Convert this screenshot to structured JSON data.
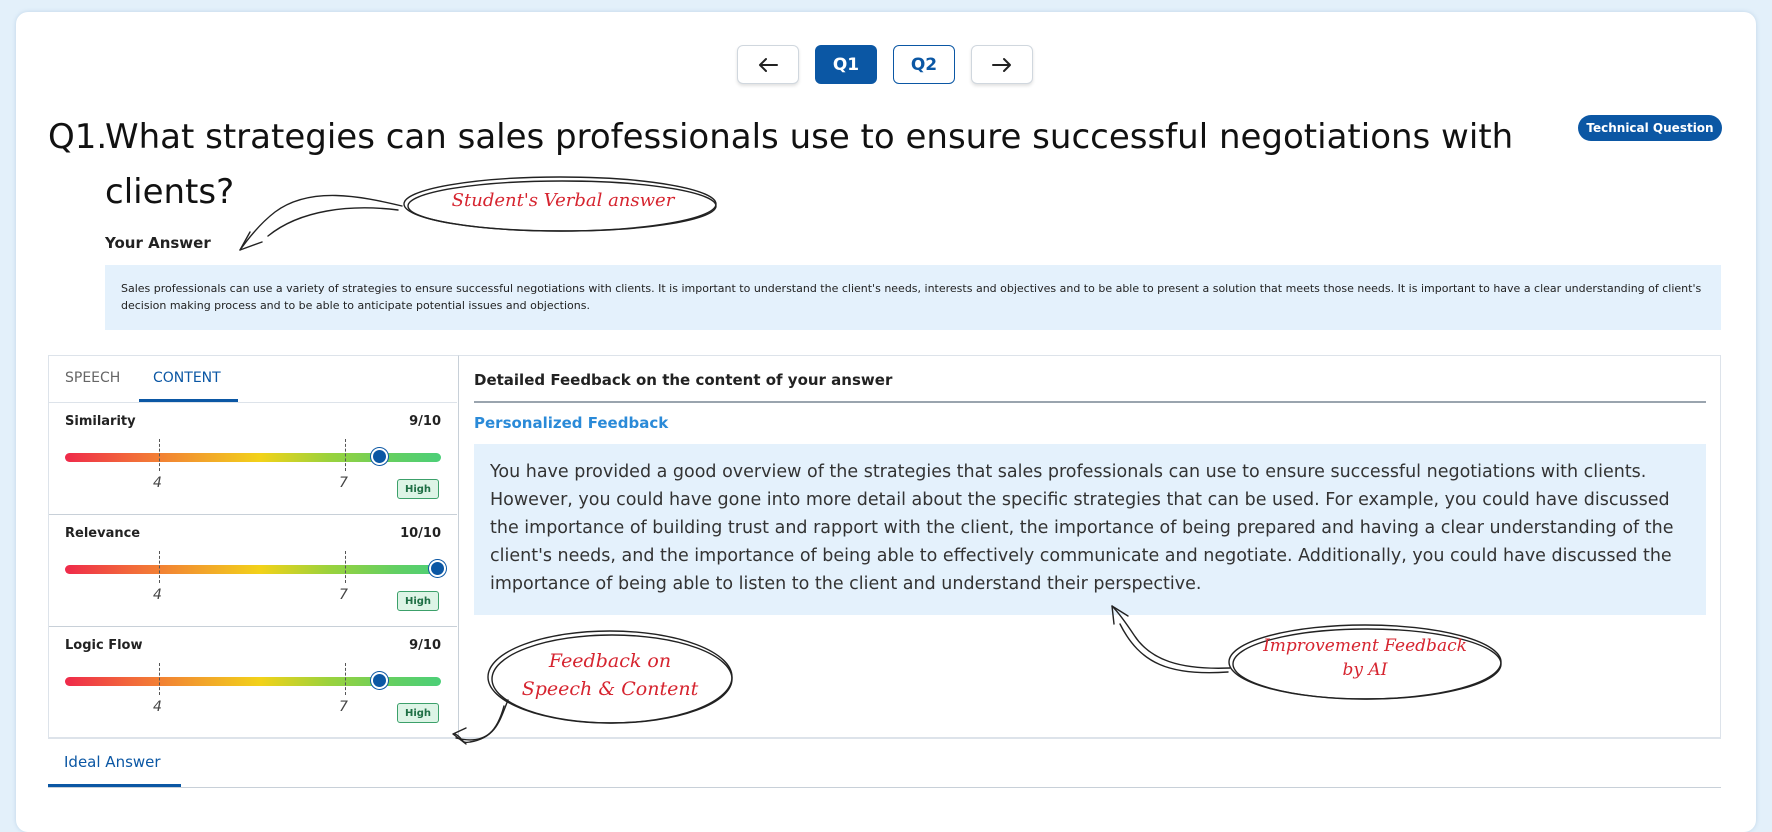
{
  "nav": {
    "prev_icon": "arrow-left-icon",
    "q1_label": "Q1",
    "q2_label": "Q2",
    "next_icon": "arrow-right-icon"
  },
  "question": {
    "number": "Q1.",
    "text": "What strategies can sales professionals use to ensure successful negotiations with clients?",
    "badge": "Technical Question"
  },
  "answer": {
    "heading": "Your Answer",
    "text": "Sales professionals can use a variety of strategies to ensure successful negotiations with clients. It is important to understand the client's needs, interests and objectives and to be able to present a solution that meets those needs. It is important to have a clear understanding of client's decision making process and to be able to anticipate potential issues and objections."
  },
  "tabs": {
    "speech": "SPEECH",
    "content": "CONTENT",
    "active": "CONTENT"
  },
  "metrics": [
    {
      "name": "Similarity",
      "score": "9/10",
      "value": 9,
      "max": 10,
      "tick_a": "4",
      "tick_b": "7",
      "level": "High"
    },
    {
      "name": "Relevance",
      "score": "10/10",
      "value": 10,
      "max": 10,
      "tick_a": "4",
      "tick_b": "7",
      "level": "High"
    },
    {
      "name": "Logic Flow",
      "score": "9/10",
      "value": 9,
      "max": 10,
      "tick_a": "4",
      "tick_b": "7",
      "level": "High"
    }
  ],
  "feedback": {
    "heading": "Detailed Feedback on the content of your answer",
    "subheading": "Personalized Feedback",
    "text": "You have provided a good overview of the strategies that sales professionals can use to ensure successful negotiations with clients. However, you could have gone into more detail about the specific strategies that can be used. For example, you could have discussed the importance of building trust and rapport with the client, the importance of being prepared and having a clear understanding of the client's needs, and the importance of being able to effectively communicate and negotiate. Additionally, you could have discussed the importance of being able to listen to the client and understand their perspective."
  },
  "ideal": {
    "tab": "Ideal Answer"
  },
  "annotations": {
    "verbal": "Student's Verbal answer",
    "speech_content_1": "Feedback on",
    "speech_content_2": "Speech & Content",
    "improvement_1": "Improvement Feedback",
    "improvement_2": "by AI"
  },
  "colors": {
    "accent": "#0b57a4",
    "link": "#2a8ad8",
    "highlight_bg": "#e4f1fc",
    "annotation": "#d6242f"
  }
}
